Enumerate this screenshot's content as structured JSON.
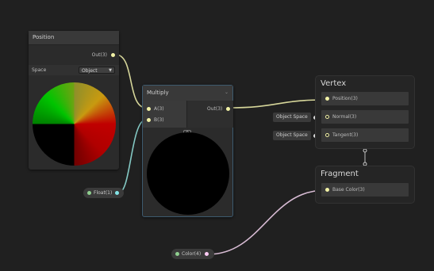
{
  "colors": {
    "background": "#202020",
    "vector3_wire": "#f2f2a6",
    "vector1_wire": "#84e4e7",
    "vector4_wire": "#fbcbf4",
    "selected_border": "#3d5a6e"
  },
  "position_node": {
    "title": "Position",
    "output_label": "Out(3)",
    "space_label": "Space",
    "space_value": "Object"
  },
  "multiply_node": {
    "title": "Multiply",
    "input_a": "A(3)",
    "input_b": "B(3)",
    "output_label": "Out(3)",
    "collapse_glyph": "^"
  },
  "float_property": {
    "label": "Float(1)"
  },
  "color_property": {
    "label": "Color(4)"
  },
  "vertex_context": {
    "title": "Vertex",
    "blocks": [
      "Position(3)",
      "Normal(3)",
      "Tangent(3)"
    ],
    "space_inputs": [
      "Object Space",
      "Object Space"
    ]
  },
  "fragment_context": {
    "title": "Fragment",
    "blocks": [
      "Base Color(3)"
    ]
  }
}
